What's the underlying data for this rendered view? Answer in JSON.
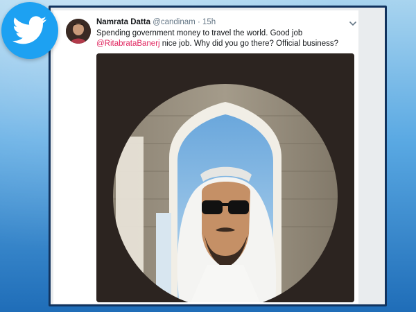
{
  "tweet": {
    "name": "Namrata Datta",
    "handle": "@candinam",
    "separator": "·",
    "time": "15h",
    "text_before": "Spending government money to travel the world. Good job ",
    "mention": "@RitabrataBanerj",
    "text_after": " nice job. Why did you go there? Official business?"
  },
  "icons": {
    "logo": "twitter-bird-icon",
    "menu": "chevron-down-icon"
  },
  "colors": {
    "twitter_blue": "#1da1f2",
    "mention": "#e0245e",
    "frame": "#11335e",
    "media_bg": "#2c2420"
  }
}
